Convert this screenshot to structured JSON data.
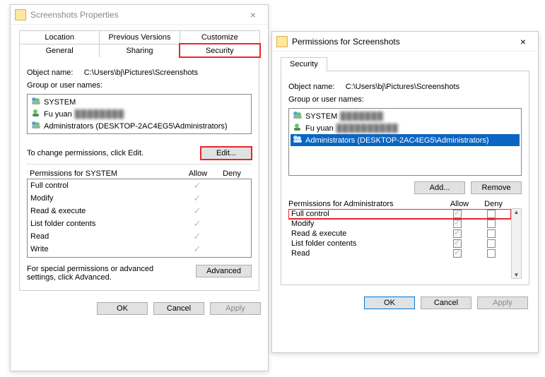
{
  "propWin": {
    "title": "Screenshots Properties",
    "tabs_row1": [
      "Location",
      "Previous Versions",
      "Customize"
    ],
    "tabs_row2": [
      "General",
      "Sharing",
      "Security"
    ],
    "objectNameLabel": "Object name:",
    "objectName": "C:\\Users\\bj\\Pictures\\Screenshots",
    "groupLabel": "Group or user names:",
    "groups": [
      {
        "name": "SYSTEM",
        "type": "group"
      },
      {
        "name": "Fu yuan",
        "type": "user",
        "blurred": true
      },
      {
        "name": "Administrators (DESKTOP-2AC4EG5\\Administrators)",
        "type": "group"
      }
    ],
    "changeHint": "To change permissions, click Edit.",
    "editBtn": "Edit...",
    "permForLabel": "Permissions for SYSTEM",
    "allow": "Allow",
    "deny": "Deny",
    "permissions": [
      "Full control",
      "Modify",
      "Read & execute",
      "List folder contents",
      "Read",
      "Write"
    ],
    "permAllow": [
      true,
      true,
      true,
      true,
      true,
      true
    ],
    "advancedHint": "For special permissions or advanced settings, click Advanced.",
    "advancedBtn": "Advanced",
    "footer": {
      "ok": "OK",
      "cancel": "Cancel",
      "apply": "Apply"
    }
  },
  "permWin": {
    "title": "Permissions for Screenshots",
    "tab": "Security",
    "objectNameLabel": "Object name:",
    "objectName": "C:\\Users\\bj\\Pictures\\Screenshots",
    "groupLabel": "Group or user names:",
    "groups": [
      {
        "name": "SYSTEM",
        "type": "group"
      },
      {
        "name": "Fu yuan",
        "type": "user",
        "blurred": true
      },
      {
        "name": "Administrators (DESKTOP-2AC4EG5\\Administrators)",
        "type": "group",
        "selected": true
      }
    ],
    "addBtn": "Add...",
    "removeBtn": "Remove",
    "permForLabel": "Permissions for Administrators",
    "allow": "Allow",
    "deny": "Deny",
    "permissions": [
      "Full control",
      "Modify",
      "Read & execute",
      "List folder contents",
      "Read"
    ],
    "permAllowDisabled": [
      true,
      true,
      true,
      true,
      true
    ],
    "footer": {
      "ok": "OK",
      "cancel": "Cancel",
      "apply": "Apply"
    }
  }
}
